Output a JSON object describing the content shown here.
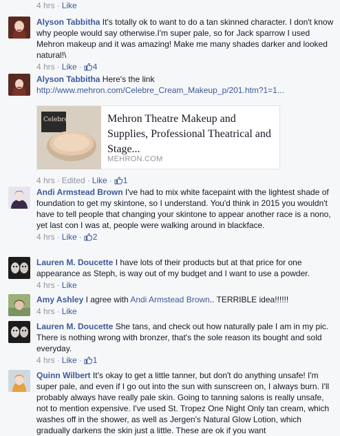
{
  "header_meta": {
    "time": "4 hrs",
    "like": "Like"
  },
  "comments": [
    {
      "author": "Alyson Tabbitha",
      "text": "It's totally ok to want to do a tan skinned character. I don't know why people would say otherwise.I'm super pale, so for Jack sparrow I used Mehron makeup and it was amazing! Make me many shades darker and looked natural!\\",
      "time": "4 hrs",
      "like": "Like",
      "likes": "4"
    },
    {
      "author": "Alyson Tabbitha",
      "text": "Here's the link",
      "link": "http://www.mehron.com/Celebre_Cream_Makeup_p/201.htm?1=1...",
      "preview": {
        "title": "Mehron Theatre Makeup and Supplies, Professional Theatrical and Stage...",
        "domain": "MEHRON.COM",
        "product_label": "Celebré"
      },
      "time": "4 hrs",
      "edited": "Edited",
      "like": "Like",
      "likes": "1"
    },
    {
      "author": "Andi Armstead Brown",
      "text": "I've had to mix white facepaint with the lightest shade of foundation to get my skintone, so I understand. You'd think in 2015 you wouldn't have to tell people that changing your skintone to appear another race is a nono, yet last con I was at, people were walking around in blackface.",
      "time": "4 hrs",
      "like": "Like",
      "likes": "2"
    },
    {
      "author": "Lauren M. Doucette",
      "text": "I have lots of their products but at that price for one appearance as Steph, is way out of my budget and I want to use a powder.",
      "time": "4 hrs",
      "like": "Like"
    },
    {
      "author": "Amy Ashley",
      "text_before": "I agree with",
      "mention": "Andi Armstead Brown",
      "text_after": ".. TERRIBLE idea!!!!!!",
      "time": "4 hrs",
      "like": "Like"
    },
    {
      "author": "Lauren M. Doucette",
      "text": "She tans, and check out how naturally pale I am in my pic. There is nothing wrong with bronzer, that's the sole reason its bought and sold everyday.",
      "time": "4 hrs",
      "like": "Like",
      "likes": "1"
    },
    {
      "author": "Quinn Wilbert",
      "text": "It's okay to get a little tanner, but don't do anything unsafe! I'm super pale, and even if I go out into the sun with sunscreen on, I always burn. I'll probably always have really pale skin. Going to tanning salons is really unsafe, not to mention expensive. I've used St. Tropez One Night Only tan cream, which washes off in the shower, as well as Jergen's Natural Glow Lotion, which gradually darkens the skin just a little. These are ok if you want"
    }
  ],
  "colors": {
    "link": "#3b5998",
    "meta": "#90949c",
    "text": "#141823",
    "background": "#f6f7f9"
  }
}
